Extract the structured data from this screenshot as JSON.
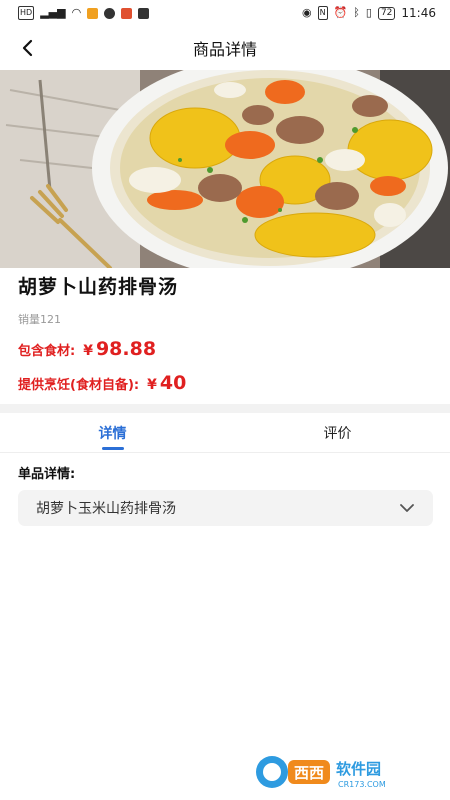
{
  "status_bar": {
    "time": "11:46",
    "battery": "72",
    "left_icons": [
      "hd-icon",
      "signal-icon",
      "wifi-icon",
      "app-notification-icon",
      "chat-icon",
      "send-icon",
      "video-icon"
    ],
    "right_icons": [
      "eye-icon",
      "nfc-icon",
      "alarm-icon",
      "bluetooth-icon",
      "vibrate-icon",
      "battery-icon"
    ]
  },
  "header": {
    "title": "商品详情"
  },
  "product": {
    "name": "胡萝卜山药排骨汤",
    "sales": "销量121",
    "price_ingredients_label": "包含食材:",
    "price_ingredients_currency": "¥",
    "price_ingredients_value": "98.88",
    "price_cooking_label": "提供烹饪(食材自备):",
    "price_cooking_currency": "¥",
    "price_cooking_value": "40"
  },
  "tabs": [
    {
      "label": "详情",
      "active": true
    },
    {
      "label": "评价",
      "active": false
    }
  ],
  "detail": {
    "section_label": "单品详情:",
    "dropdown_value": "胡萝卜玉米山药排骨汤"
  },
  "watermark": {
    "logo": "西西",
    "text": "软件园",
    "sub": "CR173.COM"
  },
  "colors": {
    "price": "#e02020",
    "tab_active": "#2b6fd6",
    "dropdown_bg": "#f3f3f3"
  }
}
